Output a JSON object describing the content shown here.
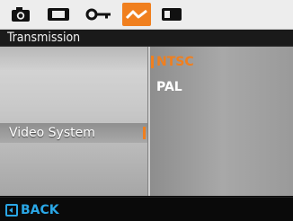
{
  "tabs": [
    {
      "icon": "camera-icon",
      "active": false
    },
    {
      "icon": "movie-icon",
      "active": false
    },
    {
      "icon": "playback-key-icon",
      "active": false
    },
    {
      "icon": "setup-wave-icon",
      "active": true
    },
    {
      "icon": "card-icon",
      "active": false
    }
  ],
  "header": {
    "title": "Transmission"
  },
  "menu": {
    "items": [
      {
        "label": "Video System",
        "selected": true
      }
    ]
  },
  "options": {
    "items": [
      {
        "label": "NTSC",
        "selected": true
      },
      {
        "label": "PAL",
        "selected": false
      }
    ]
  },
  "footer": {
    "back_label": "BACK"
  },
  "colors": {
    "accent": "#f07f1e",
    "back": "#2aa7e6",
    "text": "#ffffff"
  }
}
